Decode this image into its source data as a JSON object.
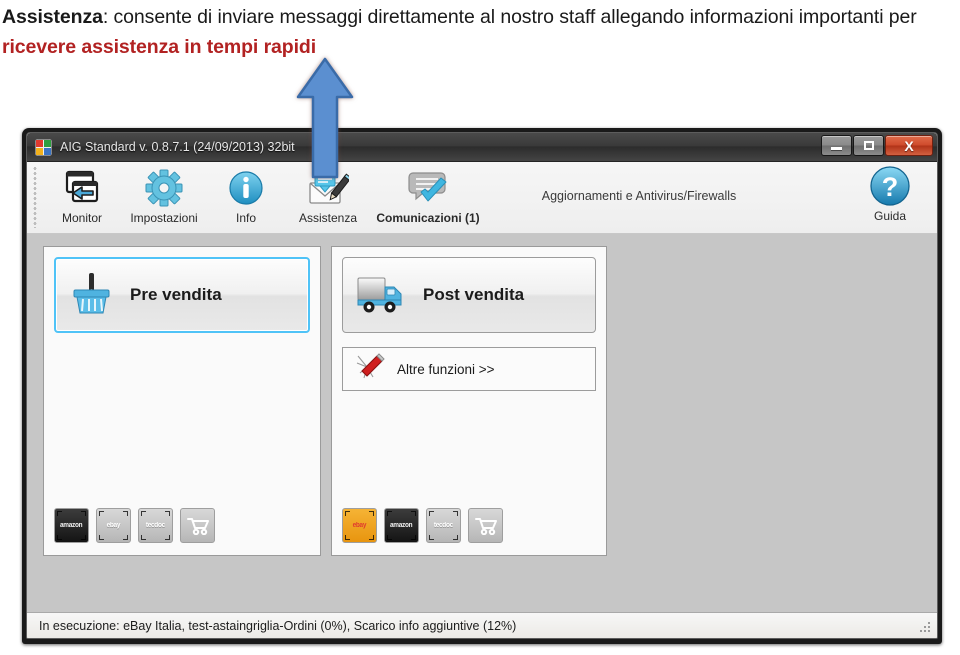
{
  "annotation": {
    "lead_bold": "Assistenza",
    "line1_rest": ": consente di inviare messaggi direttamente al nostro staff allegando",
    "line2_plain": "informazioni importanti per ",
    "line2_red": "ricevere assistenza in tempi rapidi",
    "arrow_name": "blue-up-arrow",
    "arrow_color": "#5b8fd0",
    "red_color": "#b22222"
  },
  "window": {
    "title": "AIG Standard v. 0.8.7.1 (24/09/2013) 32bit",
    "app_icon": "aig-app-icon",
    "controls": {
      "minimize": "minimize-icon",
      "maximize": "maximize-icon",
      "close": "X"
    }
  },
  "toolbar": {
    "items": [
      {
        "label": "Monitor",
        "icon": "monitor-windows-icon",
        "bold": false
      },
      {
        "label": "Impostazioni",
        "icon": "gear-icon",
        "bold": false
      },
      {
        "label": "Info",
        "icon": "info-circle-icon",
        "bold": false
      },
      {
        "label": "Assistenza",
        "icon": "envelope-pencil-icon",
        "bold": false
      },
      {
        "label": "Comunicazioni (1)",
        "icon": "speech-bubble-check-icon",
        "bold": true
      }
    ],
    "center_text": "Aggiornamenti e Antivirus/Firewalls",
    "help": {
      "label": "Guida",
      "icon": "question-mark-icon"
    }
  },
  "panels": {
    "left": {
      "primary_button": {
        "label": "Pre vendita",
        "icon": "shopping-basket-icon",
        "focused": true
      },
      "marketplaces": [
        {
          "name": "amazon",
          "logo": "amazon",
          "style": "dark"
        },
        {
          "name": "ebay",
          "logo": "ebay",
          "style": "gray"
        },
        {
          "name": "tecdoc",
          "logo": "tecdoc",
          "style": "gray"
        },
        {
          "name": "cart",
          "logo": "cart-icon",
          "style": "gray"
        }
      ]
    },
    "right": {
      "primary_button": {
        "label": "Post vendita",
        "icon": "delivery-truck-icon",
        "focused": false
      },
      "secondary_button": {
        "label": "Altre funzioni >>",
        "icon": "swiss-army-knife-icon"
      },
      "marketplaces": [
        {
          "name": "ebay",
          "logo": "ebay",
          "style": "orange"
        },
        {
          "name": "amazon",
          "logo": "amazon",
          "style": "dark"
        },
        {
          "name": "tecdoc",
          "logo": "tecdoc",
          "style": "gray"
        },
        {
          "name": "cart",
          "logo": "cart-icon",
          "style": "gray"
        }
      ]
    }
  },
  "statusbar": {
    "text": "In esecuzione: eBay Italia, test-astaingriglia-Ordini (0%), Scarico info aggiuntive (12%)",
    "resize_grip": "resize-grip-icon"
  }
}
